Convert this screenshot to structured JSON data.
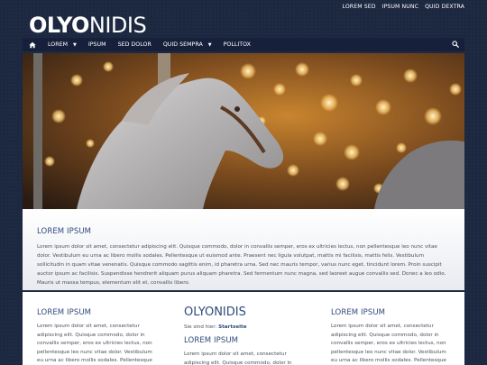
{
  "top_links": [
    "LOREM SED",
    "IPSUM NUNC",
    "QUID DEXTRA"
  ],
  "logo": {
    "bold": "OLYO",
    "light": "NIDIS"
  },
  "nav": {
    "items": [
      {
        "label": "LOREM",
        "has_menu": true
      },
      {
        "label": "IPSUM",
        "has_menu": false
      },
      {
        "label": "SED DOLOR",
        "has_menu": false
      },
      {
        "label": "QUID SEMPRA",
        "has_menu": true
      },
      {
        "label": "POLLITOX",
        "has_menu": false
      }
    ],
    "home_icon": "home-icon",
    "search_icon": "search-icon"
  },
  "hero": {
    "subject": "carousel-horse-image"
  },
  "intro": {
    "heading": "LOREM IPSUM",
    "text": "Lorem ipsum dolor sit amet, consectetur adipiscing elit. Quisque commodo, dolor in convallis semper, eros ex ultricies lectus, non pellentesque leo nunc vitae dolor. Vestibulum eu urna ac libero mollis sodales. Pellentesque ut euismod ante. Praesent nec ligula volutpat, mattis mi facilisis, mattis felis. Vestibulum sollicitudin in quam vitae venenatis. Quisque commodo sagittis enim, id pharetra urna. Sed nec mauris tempor, varius nunc eget, tincidunt lorem. Proin suscipit auctor ipsum ac facilisis. Suspendisse hendrerit aliquam purus aliquam pharetra. Sed fermentum nunc magna, sed laoreet augue convallis sed. Donec a leo odio. Mauris ut massa tempus, elementum elit et, convallis libero."
  },
  "columns": {
    "left": {
      "heading": "LOREM IPSUM",
      "text": "Lorem ipsum dolor sit amet, consectetur adipiscing elit. Quisque commodo, dolor in convallis semper, eros ex ultricies lectus, non pellentesque leo nunc vitae dolor. Vestibulum eu urna ac libero mollis sodales. Pellentesque ut euismod ante. Praesent nec"
    },
    "middle": {
      "title": "OLYONIDIS",
      "breadcrumb_prefix": "Sie sind hier:",
      "breadcrumb_link": "Startseite",
      "heading": "LOREM IPSUM",
      "text": "Lorem ipsum dolor sit amet, consectetur adipiscing elit. Quisque commodo, dolor in convallis semper,"
    },
    "right": {
      "heading": "LOREM IPSUM",
      "text": "Lorem ipsum dolor sit amet, consectetur adipiscing elit. Quisque commodo, dolor in convallis semper, eros ex ultricies lectus, non pellentesque leo nunc vitae dolor. Vestibulum eu urna ac libero mollis sodales. Pellentesque ut euismod ante. Praesent nec"
    }
  },
  "colors": {
    "background": "#1c2740",
    "nav": "#16203a",
    "heading": "#2f4a7c",
    "text": "#4a4f5a"
  }
}
